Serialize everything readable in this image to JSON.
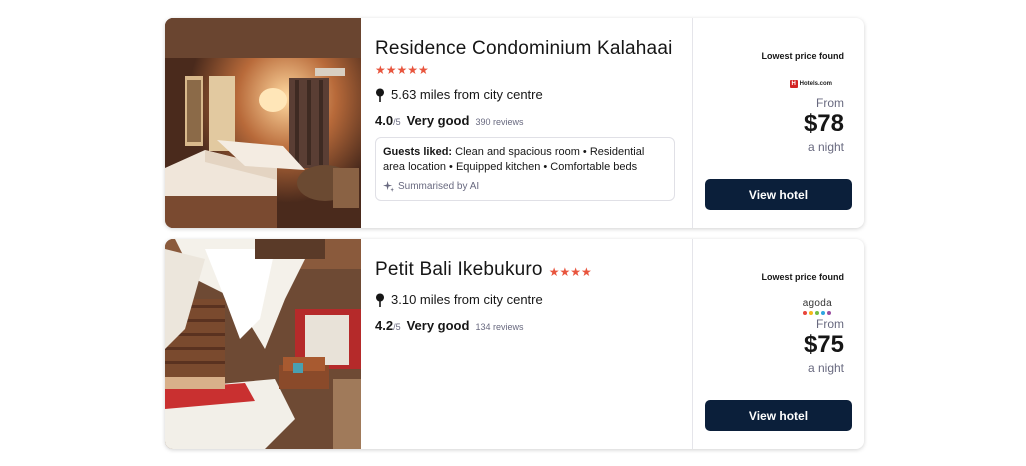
{
  "hotels": [
    {
      "name": "Residence Condominium Kalahaai",
      "stars": "★★★★★",
      "distance": "5.63 miles from city centre",
      "score": "4.0",
      "score_max": "/5",
      "rating_label": "Very good",
      "reviews": "390 reviews",
      "guests_liked_label": "Guests liked:",
      "guests_liked_text": "Clean and spacious room • Residential area location • Equipped kitchen • Comfortable beds",
      "ai_note": "Summarised by AI",
      "lowest_price_label": "Lowest price found",
      "provider": "Hotels.com",
      "provider_icon": "H",
      "from_label": "From",
      "price": "$78",
      "per_night": "a night",
      "button": "View hotel"
    },
    {
      "name": "Petit Bali Ikebukuro",
      "stars": "★★★★",
      "distance": "3.10 miles from city centre",
      "score": "4.2",
      "score_max": "/5",
      "rating_label": "Very good",
      "reviews": "134 reviews",
      "lowest_price_label": "Lowest price found",
      "provider": "agoda",
      "provider_dot_colors": [
        "#e8453c",
        "#f6b819",
        "#74be44",
        "#2ea6e0",
        "#9a4ea0"
      ],
      "from_label": "From",
      "price": "$75",
      "per_night": "a night",
      "button": "View hotel"
    }
  ],
  "colors": {
    "star": "#e8553e",
    "button_bg": "#0b1f3a",
    "muted_text": "#68697f"
  }
}
